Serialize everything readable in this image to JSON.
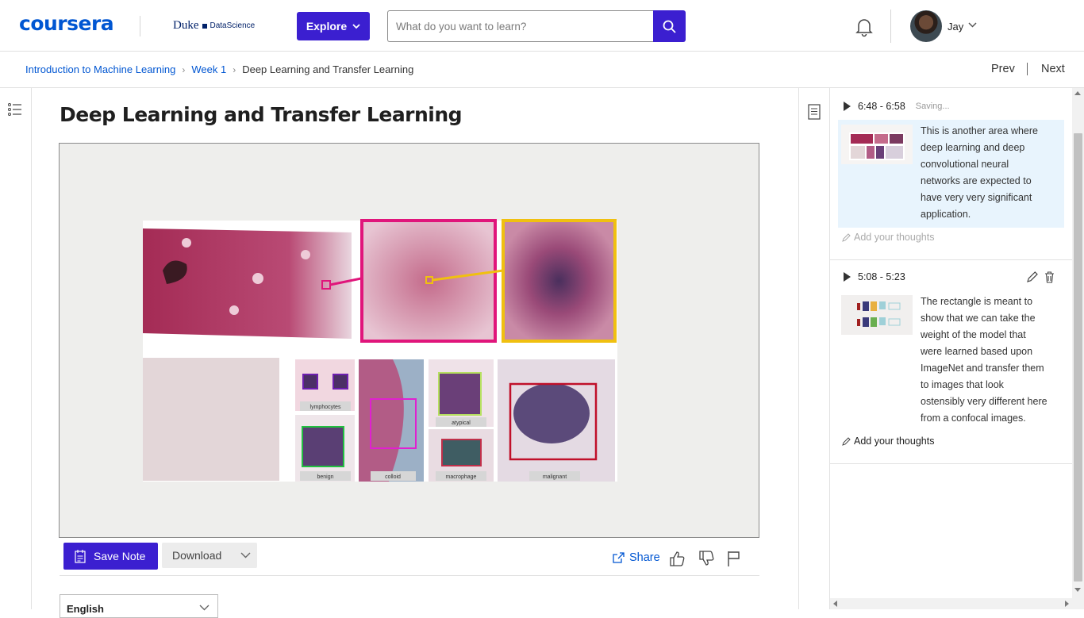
{
  "header": {
    "logo": "coursera",
    "partner": {
      "name": "Duke",
      "sub": "DataScience"
    },
    "explore_label": "Explore",
    "search_placeholder": "What do you want to learn?",
    "user_name": "Jay"
  },
  "breadcrumb": {
    "items": [
      "Introduction to Machine Learning",
      "Week 1"
    ],
    "current": "Deep Learning and Transfer Learning"
  },
  "pager": {
    "prev": "Prev",
    "next": "Next"
  },
  "lesson": {
    "title": "Deep Learning and Transfer Learning",
    "slide_labels": [
      "lymphocytes",
      "benign",
      "colloid",
      "atypical",
      "macrophage",
      "malignant"
    ]
  },
  "toolbar": {
    "save_note": "Save Note",
    "download": "Download",
    "share": "Share"
  },
  "transcript": {
    "language": "English"
  },
  "notes": [
    {
      "time": "6:48 - 6:58",
      "status": "Saving...",
      "text": "This is another area where deep learning and deep convolutional neural networks are expected to have very very significant application.",
      "add_thoughts": "Add your thoughts"
    },
    {
      "time": "5:08 - 5:23",
      "status": "",
      "text": "The rectangle is meant to show that we can take the weight of the model that were learned based upon ImageNet and transfer them to images that look ostensibly very different here from a confocal images.",
      "add_thoughts": "Add your thoughts"
    }
  ],
  "colors": {
    "brand": "#0056d2",
    "primary_button": "#3b1fd0",
    "note_highlight": "#e8f4fd"
  },
  "icons": [
    "toc-icon",
    "search-icon",
    "bell-icon",
    "chevron-down-icon",
    "note-icon",
    "share-icon",
    "thumbs-up-icon",
    "thumbs-down-icon",
    "flag-icon",
    "pencil-icon",
    "trash-icon",
    "play-icon"
  ]
}
